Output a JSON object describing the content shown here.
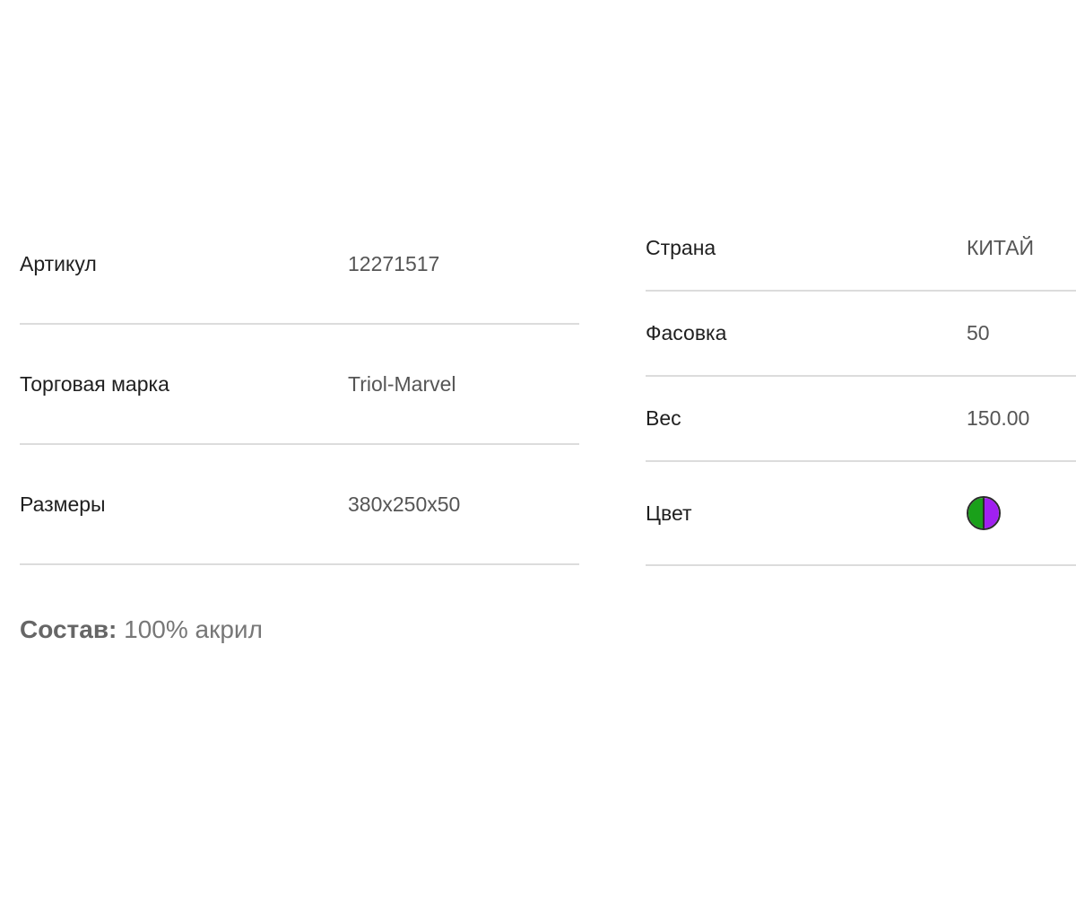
{
  "specs_left": [
    {
      "label": "Артикул",
      "value": "12271517"
    },
    {
      "label": "Торговая марка",
      "value": "Triol-Marvel"
    },
    {
      "label": "Размеры",
      "value": "380x250x50"
    }
  ],
  "specs_right": [
    {
      "label": "Страна",
      "value": "КИТАЙ"
    },
    {
      "label": "Фасовка",
      "value": "50"
    },
    {
      "label": "Вес",
      "value": "150.00"
    },
    {
      "label": "Цвет"
    }
  ],
  "color_swatch": {
    "colors": [
      "#1aa01a",
      "#a020f0"
    ],
    "icon": "color-swatch-icon"
  },
  "composition": {
    "label": "Состав:",
    "value": "100% акрил"
  }
}
